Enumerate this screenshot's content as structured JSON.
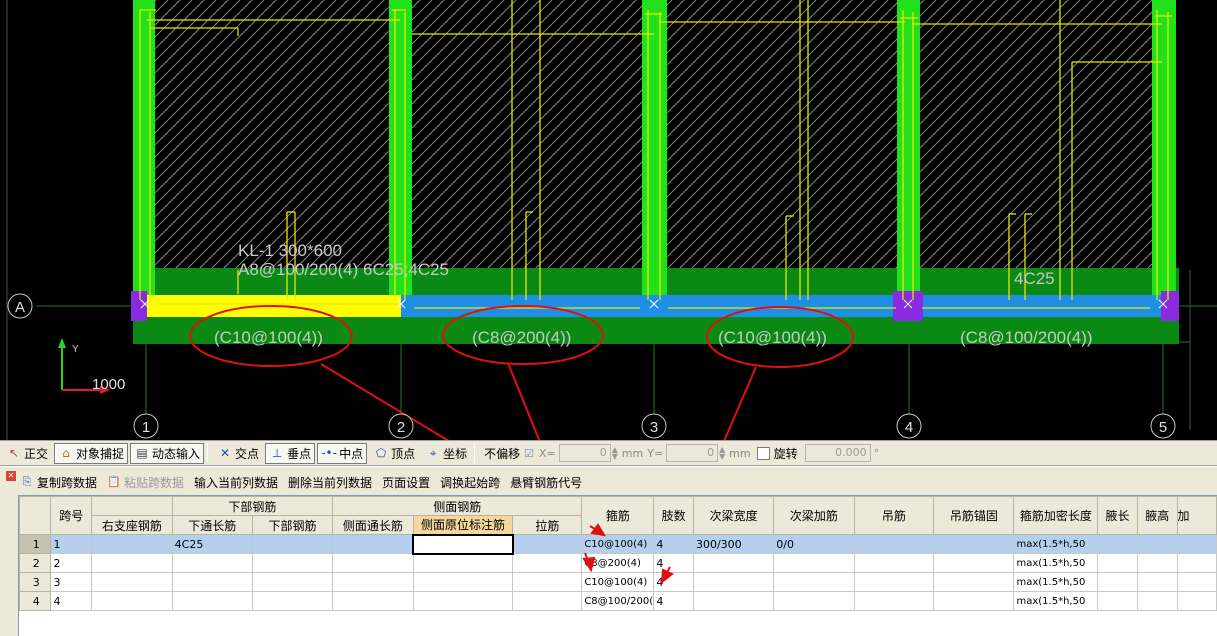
{
  "drawing": {
    "beam_label_line1": "KL-1 300*600",
    "beam_label_line2": "A8@100/200(4) 6C25;4C25",
    "top_label": "4C25",
    "axis_row": "A",
    "axis_cols": [
      "1",
      "2",
      "3",
      "4",
      "5"
    ],
    "span_stirrups": [
      "(C10@100(4))",
      "(C8@200(4))",
      "(C10@100(4))",
      "(C8@100/200(4))"
    ],
    "ucs_y": "Y",
    "ucs_value": "1000"
  },
  "toolbar": {
    "items": [
      {
        "label": "正交",
        "icon": "ortho-icon"
      },
      {
        "label": "对象捕捉",
        "icon": "snap-icon"
      },
      {
        "label": "动态输入",
        "icon": "dynamic-input-icon"
      },
      {
        "label": "交点",
        "icon": "intersection-icon"
      },
      {
        "label": "垂点",
        "icon": "perpendicular-icon"
      },
      {
        "label": "中点",
        "icon": "midpoint-icon"
      },
      {
        "label": "顶点",
        "icon": "vertex-icon"
      },
      {
        "label": "坐标",
        "icon": "coordinate-icon"
      }
    ],
    "offset_mode": "不偏移",
    "x_label": "X=",
    "x_value": "0",
    "y_label": "Y=",
    "y_value": "0",
    "unit": "mm",
    "rotate_label": "旋转",
    "rotate_value": "0.000",
    "degree": "°"
  },
  "panel_toolbar": {
    "copy": "复制跨数据",
    "paste": "粘贴跨数据",
    "input_col": "输入当前列数据",
    "delete_col": "删除当前列数据",
    "page_setup": "页面设置",
    "swap_start": "调换起始跨",
    "cantilever": "悬臂钢筋代号"
  },
  "grid": {
    "group_headers": {
      "bottom": "下部钢筋",
      "side": "侧面钢筋"
    },
    "headers": {
      "span": "跨号",
      "right_support": "右支座钢筋",
      "bottom_through": "下通长筋",
      "bottom": "下部钢筋",
      "side_through": "侧面通长筋",
      "side_original": "侧面原位标注筋",
      "tie": "拉筋",
      "stirrup": "箍筋",
      "legs": "肢数",
      "sub_width": "次梁宽度",
      "sub_add": "次梁加筋",
      "hanger": "吊筋",
      "hanger_anchor": "吊筋锚固",
      "dense_len": "箍筋加密长度",
      "haunch_len": "腋长",
      "haunch_h": "腋高",
      "extra": "加"
    },
    "rows": [
      {
        "num": "1",
        "span": "1",
        "right_support": "",
        "bottom_through": "4C25",
        "bottom": "",
        "side_through": "",
        "side_original": "",
        "tie": "",
        "stirrup": "C10@100(4)",
        "legs": "4",
        "sub_width": "300/300",
        "sub_add": "0/0",
        "hanger": "",
        "hanger_anchor": "",
        "dense_len": "max(1.5*h,50"
      },
      {
        "num": "2",
        "span": "2",
        "right_support": "",
        "bottom_through": "",
        "bottom": "",
        "side_through": "",
        "side_original": "",
        "tie": "",
        "stirrup": "C8@200(4)",
        "legs": "4",
        "sub_width": "",
        "sub_add": "",
        "hanger": "",
        "hanger_anchor": "",
        "dense_len": "max(1.5*h,50"
      },
      {
        "num": "3",
        "span": "3",
        "right_support": "",
        "bottom_through": "",
        "bottom": "",
        "side_through": "",
        "side_original": "",
        "tie": "",
        "stirrup": "C10@100(4)",
        "legs": "4",
        "sub_width": "",
        "sub_add": "",
        "hanger": "",
        "hanger_anchor": "",
        "dense_len": "max(1.5*h,50"
      },
      {
        "num": "4",
        "span": "4",
        "right_support": "",
        "bottom_through": "",
        "bottom": "",
        "side_through": "",
        "side_original": "",
        "tie": "",
        "stirrup": "C8@100/200(",
        "legs": "4",
        "sub_width": "",
        "sub_add": "",
        "hanger": "",
        "hanger_anchor": "",
        "dense_len": "max(1.5*h,50"
      }
    ]
  },
  "colors": {
    "column_green": "#21e11b",
    "beam_green": "#0a8a14",
    "beam_blue": "#1f8fe6",
    "beam_selected": "#ffff00",
    "rebar_yellow": "#e6e600",
    "axis_green": "#2f9f2f",
    "support_purple": "#8a2be2",
    "annotation_red": "#e01010"
  }
}
